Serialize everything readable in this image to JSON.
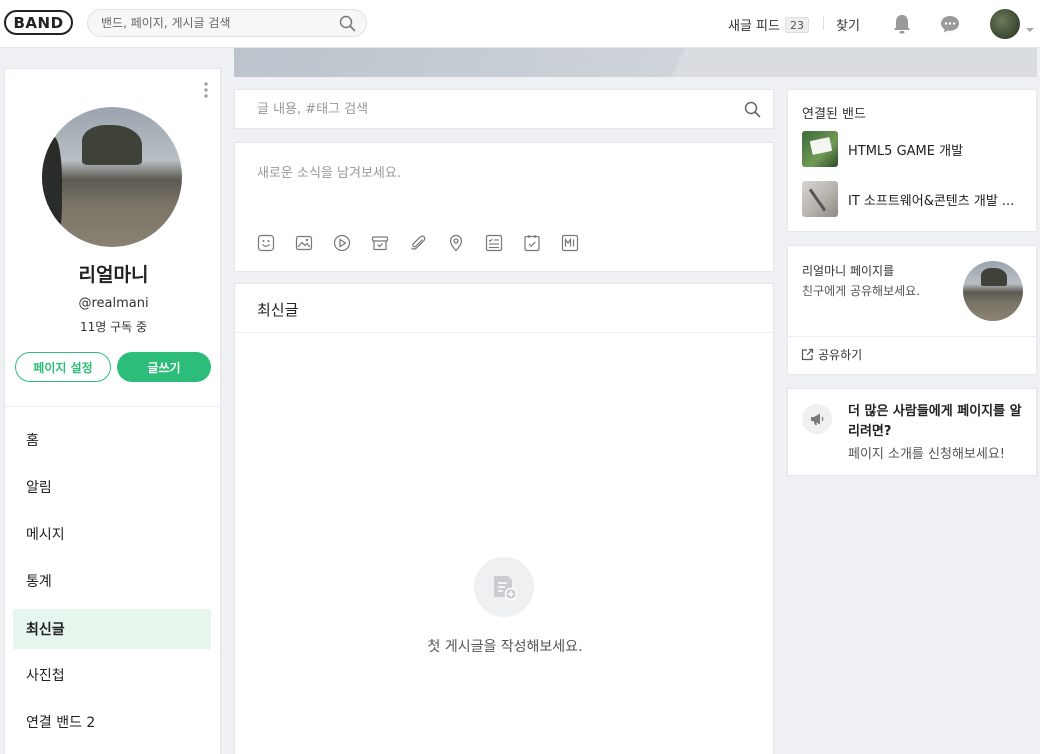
{
  "header": {
    "logo": "BAND",
    "search_placeholder": "밴드, 페이지, 게시글 검색",
    "feed_label": "새글 피드",
    "feed_count": "23",
    "find_label": "찾기"
  },
  "profile": {
    "name": "리얼마니",
    "handle": "@realmani",
    "subscribers": "11명 구독 중",
    "settings_button": "페이지 설정",
    "write_button": "글쓰기"
  },
  "nav": {
    "items": [
      {
        "label": "홈"
      },
      {
        "label": "알림"
      },
      {
        "label": "메시지"
      },
      {
        "label": "통계"
      },
      {
        "label": "최신글",
        "active": true
      },
      {
        "label": "사진첩"
      },
      {
        "label": "연결 밴드 2"
      }
    ]
  },
  "center": {
    "post_search_placeholder": "글 내용, #태그 검색",
    "composer_placeholder": "새로운 소식을 남겨보세요.",
    "tools": [
      "emoji-icon",
      "image-icon",
      "video-icon",
      "archive-icon",
      "attach-icon",
      "location-icon",
      "checklist-icon",
      "schedule-icon",
      "markdown-icon"
    ],
    "feed_title": "최신글",
    "empty_text": "첫 게시글을 작성해보세요."
  },
  "right": {
    "linked_title": "연결된 밴드",
    "bands": [
      {
        "name": "HTML5 GAME 개발"
      },
      {
        "name": "IT 소프트웨어&콘텐츠 개발 ..."
      }
    ],
    "share_line1": "리얼마니 페이지를",
    "share_line2": "친구에게 공유해보세요.",
    "share_link": "공유하기",
    "promo_title": "더 많은 사람들에게 페이지를 알리려면?",
    "promo_sub": "페이지 소개를 신청해보세요!"
  },
  "colors": {
    "accent": "#2dbd7a",
    "active_nav_bg": "#e7f6ed",
    "background": "#eef0f3"
  }
}
